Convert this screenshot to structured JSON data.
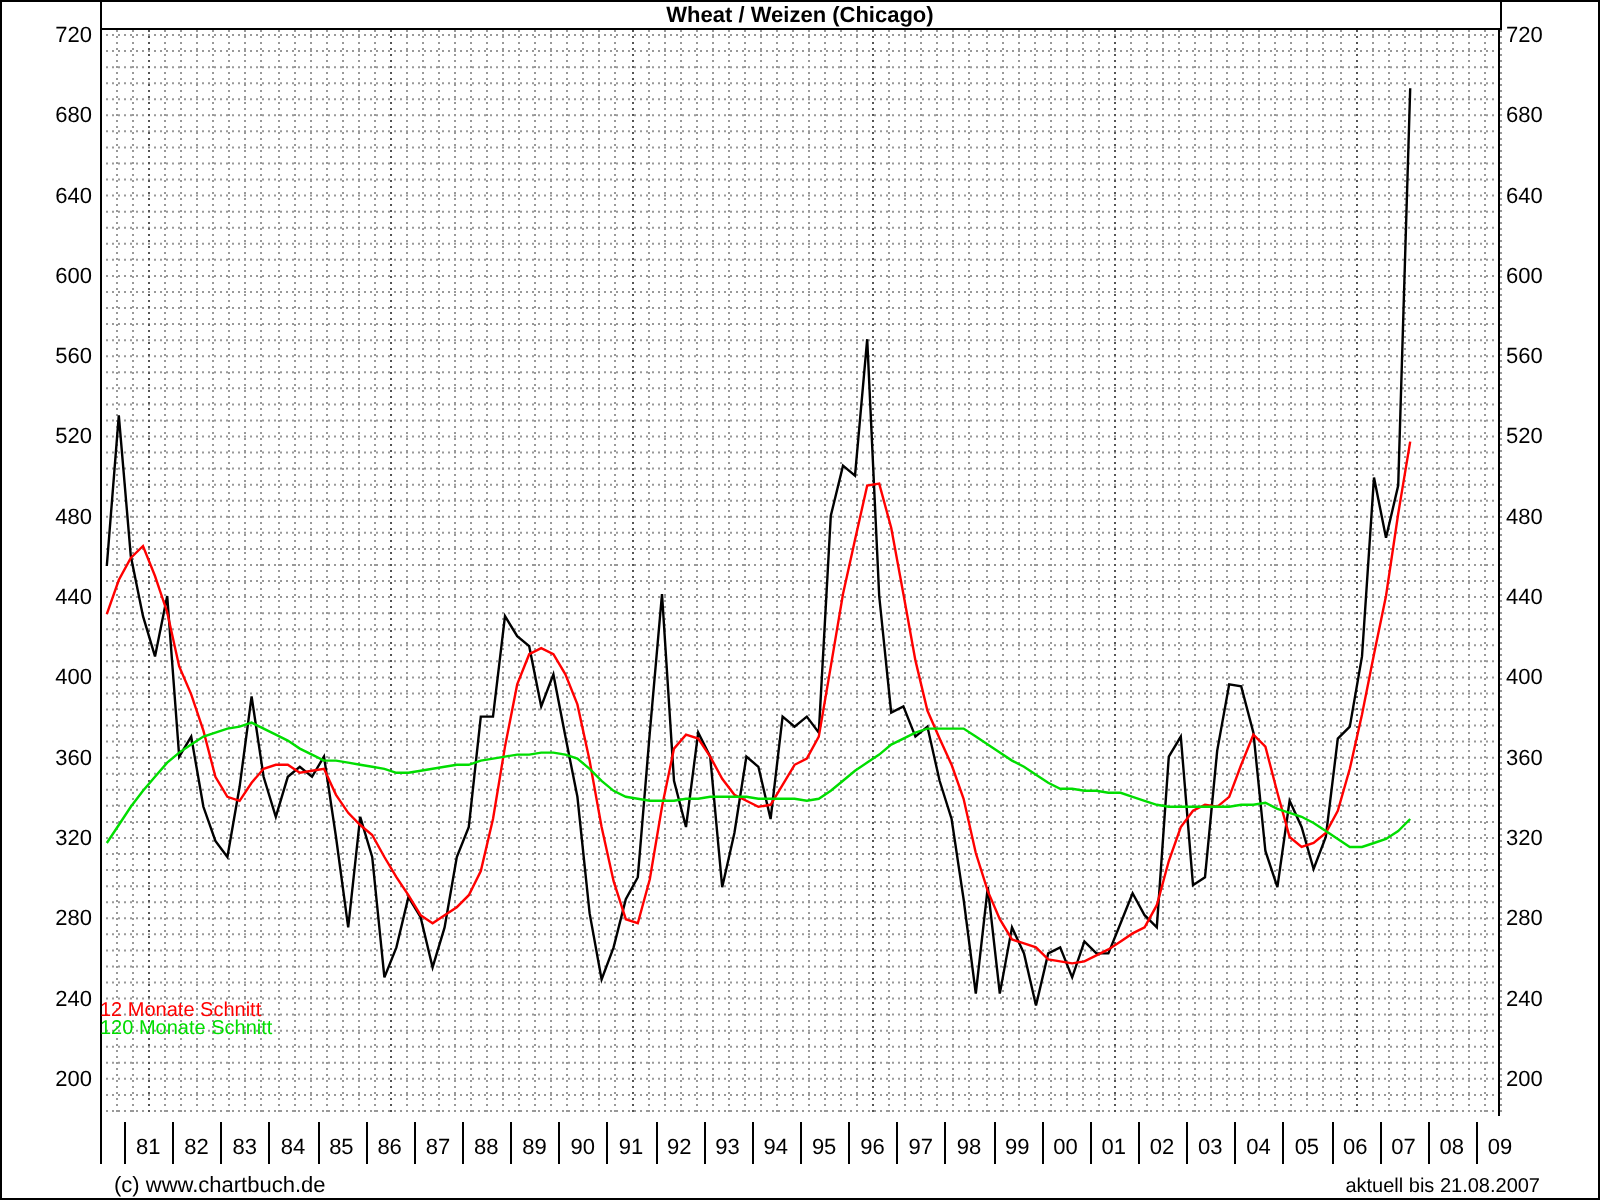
{
  "chart": {
    "chart_data": {
      "type": "line",
      "title": "Wheat / Weizen (Chicago)",
      "grid": true,
      "xlim": [
        1980,
        2009
      ],
      "ylim": [
        181,
        722
      ],
      "yticks": [
        200,
        240,
        280,
        320,
        360,
        400,
        440,
        480,
        520,
        560,
        600,
        640,
        680,
        720
      ],
      "xticks": [
        {
          "value": 1981,
          "label": "81"
        },
        {
          "value": 1982,
          "label": "82"
        },
        {
          "value": 1983,
          "label": "83"
        },
        {
          "value": 1984,
          "label": "84"
        },
        {
          "value": 1985,
          "label": "85"
        },
        {
          "value": 1986,
          "label": "86"
        },
        {
          "value": 1987,
          "label": "87"
        },
        {
          "value": 1988,
          "label": "88"
        },
        {
          "value": 1989,
          "label": "89"
        },
        {
          "value": 1990,
          "label": "90"
        },
        {
          "value": 1991,
          "label": "91"
        },
        {
          "value": 1992,
          "label": "92"
        },
        {
          "value": 1993,
          "label": "93"
        },
        {
          "value": 1994,
          "label": "94"
        },
        {
          "value": 1995,
          "label": "95"
        },
        {
          "value": 1996,
          "label": "96"
        },
        {
          "value": 1997,
          "label": "97"
        },
        {
          "value": 1998,
          "label": "98"
        },
        {
          "value": 1999,
          "label": "99"
        },
        {
          "value": 2000,
          "label": "00"
        },
        {
          "value": 2001,
          "label": "01"
        },
        {
          "value": 2002,
          "label": "02"
        },
        {
          "value": 2003,
          "label": "03"
        },
        {
          "value": 2004,
          "label": "04"
        },
        {
          "value": 2005,
          "label": "05"
        },
        {
          "value": 2006,
          "label": "06"
        },
        {
          "value": 2007,
          "label": "07"
        },
        {
          "value": 2008,
          "label": "08"
        },
        {
          "value": 2009,
          "label": "09"
        }
      ],
      "x": [
        1980.14,
        1980.39,
        1980.64,
        1980.89,
        1981.14,
        1981.39,
        1981.64,
        1981.89,
        1982.14,
        1982.39,
        1982.64,
        1982.89,
        1983.14,
        1983.39,
        1983.64,
        1983.89,
        1984.14,
        1984.39,
        1984.64,
        1984.89,
        1985.14,
        1985.39,
        1985.64,
        1985.89,
        1986.14,
        1986.39,
        1986.64,
        1986.89,
        1987.14,
        1987.39,
        1987.64,
        1987.89,
        1988.14,
        1988.39,
        1988.64,
        1988.89,
        1989.14,
        1989.39,
        1989.64,
        1989.89,
        1990.14,
        1990.39,
        1990.64,
        1990.89,
        1991.14,
        1991.39,
        1991.64,
        1991.89,
        1992.14,
        1992.39,
        1992.64,
        1992.89,
        1993.14,
        1993.39,
        1993.64,
        1993.89,
        1994.14,
        1994.39,
        1994.64,
        1994.89,
        1995.14,
        1995.39,
        1995.64,
        1995.89,
        1996.14,
        1996.39,
        1996.64,
        1996.89,
        1997.14,
        1997.39,
        1997.64,
        1997.89,
        1998.14,
        1998.39,
        1998.64,
        1998.89,
        1999.14,
        1999.39,
        1999.64,
        1999.89,
        2000.14,
        2000.39,
        2000.64,
        2000.89,
        2001.14,
        2001.39,
        2001.64,
        2001.89,
        2002.14,
        2002.39,
        2002.64,
        2002.89,
        2003.14,
        2003.39,
        2003.64,
        2003.89,
        2004.14,
        2004.39,
        2004.64,
        2004.89,
        2005.14,
        2005.39,
        2005.64,
        2005.89,
        2006.14,
        2006.39,
        2006.64,
        2006.89,
        2007.14
      ],
      "series": [
        {
          "color": "#000000",
          "values": [
            455,
            530,
            460,
            430,
            410,
            440,
            360,
            370,
            335,
            318,
            310,
            345,
            390,
            350,
            330,
            350,
            355,
            350,
            360,
            320,
            275,
            330,
            310,
            250,
            265,
            290,
            280,
            255,
            275,
            310,
            325,
            380,
            380,
            430,
            420,
            415,
            385,
            401,
            370,
            340,
            282,
            249,
            265,
            289,
            300,
            372,
            441,
            348,
            325,
            372,
            360,
            295,
            322,
            360,
            355,
            329,
            380,
            375,
            380,
            372,
            480,
            505,
            500,
            568,
            440,
            382,
            385,
            370,
            375,
            348,
            329,
            289,
            242,
            295,
            242,
            275,
            262,
            236,
            262,
            265,
            250,
            268,
            262,
            262,
            277,
            292,
            281,
            275,
            360,
            370,
            296,
            300,
            363,
            396,
            395,
            372,
            313,
            295,
            338,
            325,
            304,
            320,
            369,
            375,
            410,
            499,
            469,
            495,
            693
          ]
        },
        {
          "name": "12 Monate Schnitt",
          "color": "#ff0000",
          "values": [
            431,
            448,
            459,
            465,
            450,
            432,
            405,
            391,
            373,
            350,
            340,
            338,
            347,
            354,
            356,
            356,
            352,
            353,
            354,
            341,
            332,
            326,
            321,
            310,
            300,
            291,
            281,
            277,
            281,
            285,
            291,
            303,
            329,
            365,
            396,
            411,
            414,
            411,
            401,
            386,
            358,
            325,
            298,
            279,
            277,
            299,
            335,
            364,
            371,
            369,
            360,
            349,
            341,
            338,
            335,
            336,
            346,
            356,
            359,
            370,
            405,
            441,
            468,
            495,
            496,
            474,
            441,
            408,
            383,
            369,
            356,
            339,
            312,
            293,
            279,
            269,
            267,
            265,
            259,
            258,
            257,
            258,
            261,
            264,
            268,
            272,
            275,
            286,
            308,
            325,
            333,
            336,
            335,
            340,
            356,
            371,
            365,
            342,
            320,
            315,
            317,
            322,
            333,
            354,
            381,
            411,
            440,
            481,
            517
          ]
        },
        {
          "name": "120 Monate Schnitt",
          "color": "#00dd00",
          "values": [
            317,
            326,
            335,
            343,
            350,
            357,
            362,
            366,
            370,
            372,
            374,
            375,
            377,
            374,
            371,
            368,
            364,
            361,
            358,
            358,
            357,
            356,
            355,
            354,
            352,
            352,
            353,
            354,
            355,
            356,
            356,
            358,
            359,
            360,
            361,
            361,
            362,
            362,
            361,
            359,
            354,
            348,
            343,
            340,
            339,
            338,
            338,
            338,
            339,
            339,
            340,
            340,
            340,
            340,
            339,
            339,
            339,
            339,
            338,
            339,
            343,
            348,
            353,
            357,
            361,
            366,
            369,
            372,
            374,
            374,
            374,
            374,
            370,
            366,
            362,
            358,
            355,
            351,
            347,
            344,
            344,
            343,
            343,
            342,
            342,
            340,
            338,
            336,
            335,
            335,
            335,
            335,
            335,
            335,
            336,
            336,
            337,
            334,
            332,
            330,
            327,
            323,
            319,
            315,
            315,
            317,
            319,
            323,
            329
          ]
        }
      ]
    },
    "left_axis": {
      "labels": [
        "720",
        "680",
        "640",
        "600",
        "560",
        "520",
        "480",
        "440",
        "400",
        "360",
        "320",
        "280",
        "240",
        "200"
      ]
    },
    "right_axis": {
      "labels": [
        "720",
        "680",
        "640",
        "600",
        "560",
        "520",
        "480",
        "440",
        "400",
        "360",
        "320",
        "280",
        "240",
        "200"
      ]
    }
  },
  "footer": {
    "copyright": "(c) www.chartbuch.de",
    "updated": "aktuell bis 21.08.2007"
  }
}
